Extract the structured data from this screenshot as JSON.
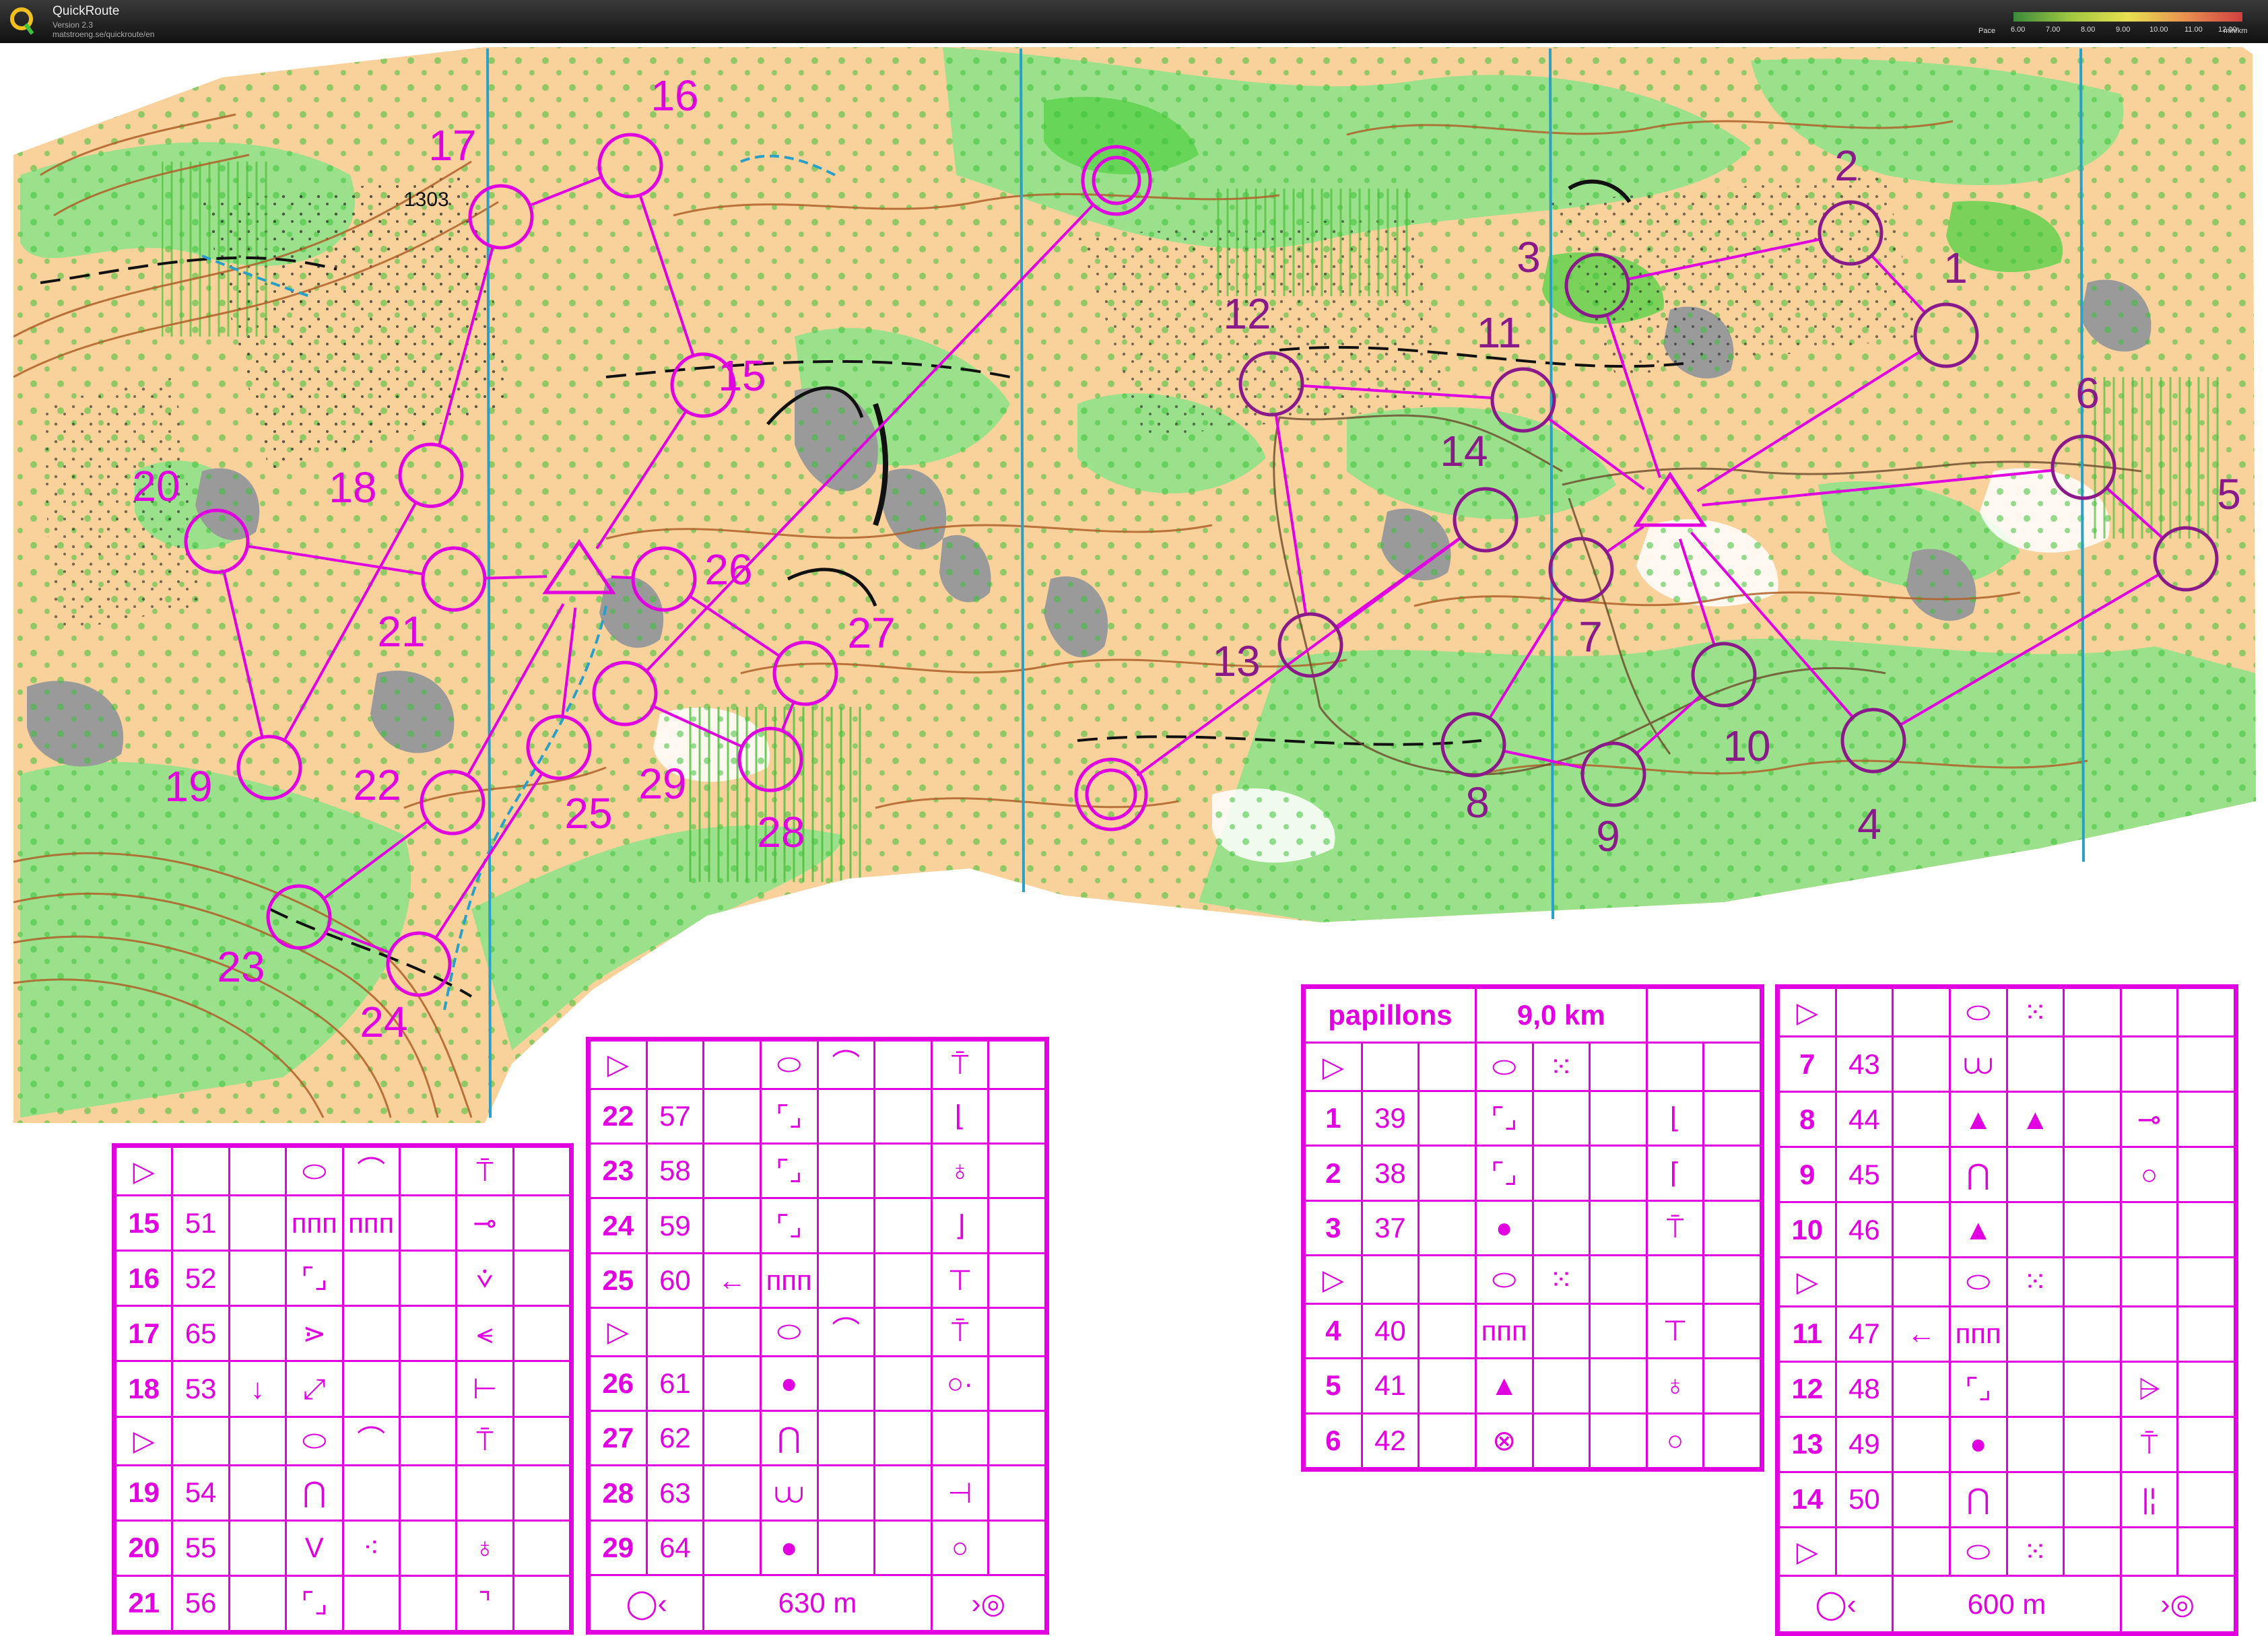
{
  "app": {
    "title": "QuickRoute",
    "version": "Version 2.3",
    "url": "matstroeng.se/quickroute/en"
  },
  "pace_legend": {
    "label": "Pace",
    "ticks": [
      "6.00",
      "7.00",
      "8.00",
      "9.00",
      "10.00",
      "11.00",
      "12.00"
    ],
    "unit": "min/km"
  },
  "map": {
    "spot_height": "1303",
    "control_labels": [
      "1",
      "2",
      "3",
      "4",
      "5",
      "6",
      "7",
      "8",
      "9",
      "10",
      "11",
      "12",
      "13",
      "14",
      "15",
      "16",
      "17",
      "18",
      "19",
      "20",
      "21",
      "22",
      "23",
      "24",
      "25",
      "26",
      "27",
      "28",
      "29"
    ]
  },
  "colors": {
    "course": "#e000e0",
    "route": "#7a1a6a",
    "open_land": "#f7c98a",
    "forest": "#8fdc7a",
    "contour": "#b0602a",
    "rock": "#999999",
    "water": "#2aa0c8"
  },
  "descriptions": {
    "course_name": "papillons",
    "course_length": "9,0 km",
    "table_a": {
      "rows": [
        {
          "type": "start",
          "symbols": [
            "▷",
            "",
            "",
            "⬭",
            "⌒",
            "",
            "⍑",
            ""
          ]
        },
        {
          "type": "control",
          "num": "15",
          "code": "51",
          "symbols": [
            "",
            "ᴨᴨᴨ",
            "ᴨᴨᴨ",
            "",
            "⊸",
            ""
          ]
        },
        {
          "type": "control",
          "num": "16",
          "code": "52",
          "symbols": [
            "",
            "⌜⌟",
            "",
            "",
            "⩒",
            ""
          ]
        },
        {
          "type": "control",
          "num": "17",
          "code": "65",
          "symbols": [
            "",
            "⋗",
            "",
            "",
            "⪪",
            ""
          ]
        },
        {
          "type": "control",
          "num": "18",
          "code": "53",
          "symbols": [
            "↓",
            "⤢",
            "",
            "",
            "⊢",
            ""
          ]
        },
        {
          "type": "start",
          "symbols": [
            "▷",
            "",
            "",
            "⬭",
            "⌒",
            "",
            "⍑",
            ""
          ]
        },
        {
          "type": "control",
          "num": "19",
          "code": "54",
          "symbols": [
            "",
            "⋂",
            "",
            "",
            "",
            ""
          ]
        },
        {
          "type": "control",
          "num": "20",
          "code": "55",
          "symbols": [
            "",
            "V",
            "⁖",
            "",
            "♁",
            ""
          ]
        },
        {
          "type": "control",
          "num": "21",
          "code": "56",
          "symbols": [
            "",
            "⌜⌟",
            "",
            "",
            "⌝",
            ""
          ]
        }
      ]
    },
    "table_b": {
      "rows": [
        {
          "type": "start",
          "symbols": [
            "▷",
            "",
            "",
            "⬭",
            "⌒",
            "",
            "⍑",
            ""
          ]
        },
        {
          "type": "control",
          "num": "22",
          "code": "57",
          "symbols": [
            "",
            "⌜⌟",
            "",
            "",
            "⌊",
            ""
          ]
        },
        {
          "type": "control",
          "num": "23",
          "code": "58",
          "symbols": [
            "",
            "⌜⌟",
            "",
            "",
            "♁",
            ""
          ]
        },
        {
          "type": "control",
          "num": "24",
          "code": "59",
          "symbols": [
            "",
            "⌜⌟",
            "",
            "",
            "⌋",
            ""
          ]
        },
        {
          "type": "control",
          "num": "25",
          "code": "60",
          "symbols": [
            "←",
            "ᴨᴨᴨ",
            "",
            "",
            "⊤",
            ""
          ]
        },
        {
          "type": "start",
          "symbols": [
            "▷",
            "",
            "",
            "⬭",
            "⌒",
            "",
            "⍑",
            ""
          ]
        },
        {
          "type": "control",
          "num": "26",
          "code": "61",
          "symbols": [
            "",
            "●",
            "",
            "",
            "○·",
            ""
          ]
        },
        {
          "type": "control",
          "num": "27",
          "code": "62",
          "symbols": [
            "",
            "⋂",
            "",
            "",
            "",
            ""
          ]
        },
        {
          "type": "control",
          "num": "28",
          "code": "63",
          "symbols": [
            "",
            "⩊",
            "",
            "",
            "⊣",
            ""
          ]
        },
        {
          "type": "control",
          "num": "29",
          "code": "64",
          "symbols": [
            "",
            "●",
            "",
            "",
            "○",
            ""
          ]
        }
      ],
      "footer": "630 m"
    },
    "table_c": {
      "rows": [
        {
          "type": "start",
          "symbols": [
            "▷",
            "",
            "",
            "⬭",
            "⁙",
            "",
            "",
            ""
          ]
        },
        {
          "type": "control",
          "num": "1",
          "code": "39",
          "symbols": [
            "",
            "⌜⌟",
            "",
            "",
            "⌊",
            ""
          ]
        },
        {
          "type": "control",
          "num": "2",
          "code": "38",
          "symbols": [
            "",
            "⌜⌟",
            "",
            "",
            "⌈",
            ""
          ]
        },
        {
          "type": "control",
          "num": "3",
          "code": "37",
          "symbols": [
            "",
            "●",
            "",
            "",
            "⍑",
            ""
          ]
        },
        {
          "type": "start",
          "symbols": [
            "▷",
            "",
            "",
            "⬭",
            "⁙",
            "",
            "",
            ""
          ]
        },
        {
          "type": "control",
          "num": "4",
          "code": "40",
          "symbols": [
            "",
            "ᴨᴨᴨ",
            "",
            "",
            "⊤",
            ""
          ]
        },
        {
          "type": "control",
          "num": "5",
          "code": "41",
          "symbols": [
            "",
            "▲",
            "",
            "",
            "♁",
            ""
          ]
        },
        {
          "type": "control",
          "num": "6",
          "code": "42",
          "symbols": [
            "",
            "⊗",
            "",
            "",
            "○",
            ""
          ]
        }
      ]
    },
    "table_d": {
      "rows": [
        {
          "type": "start",
          "symbols": [
            "▷",
            "",
            "",
            "⬭",
            "⁙",
            "",
            "",
            ""
          ]
        },
        {
          "type": "control",
          "num": "7",
          "code": "43",
          "symbols": [
            "",
            "⩊",
            "",
            "",
            "",
            ""
          ]
        },
        {
          "type": "control",
          "num": "8",
          "code": "44",
          "symbols": [
            "",
            "▲",
            "▲",
            "",
            "⊸",
            ""
          ]
        },
        {
          "type": "control",
          "num": "9",
          "code": "45",
          "symbols": [
            "",
            "⋂",
            "",
            "",
            "○",
            ""
          ]
        },
        {
          "type": "control",
          "num": "10",
          "code": "46",
          "symbols": [
            "",
            "▲",
            "",
            "",
            "",
            ""
          ]
        },
        {
          "type": "start",
          "symbols": [
            "▷",
            "",
            "",
            "⬭",
            "⁙",
            "",
            "",
            ""
          ]
        },
        {
          "type": "control",
          "num": "11",
          "code": "47",
          "symbols": [
            "←",
            "ᴨᴨᴨ",
            "",
            "",
            "",
            ""
          ]
        },
        {
          "type": "control",
          "num": "12",
          "code": "48",
          "symbols": [
            "",
            "⌜⌟",
            "",
            "",
            "⩥",
            ""
          ]
        },
        {
          "type": "control",
          "num": "13",
          "code": "49",
          "symbols": [
            "",
            "●",
            "",
            "",
            "⍑",
            ""
          ]
        },
        {
          "type": "control",
          "num": "14",
          "code": "50",
          "symbols": [
            "",
            "⋂",
            "",
            "",
            "|¦",
            ""
          ]
        },
        {
          "type": "start",
          "symbols": [
            "▷",
            "",
            "",
            "⬭",
            "⁙",
            "",
            "",
            ""
          ]
        }
      ],
      "footer": "600 m"
    }
  }
}
